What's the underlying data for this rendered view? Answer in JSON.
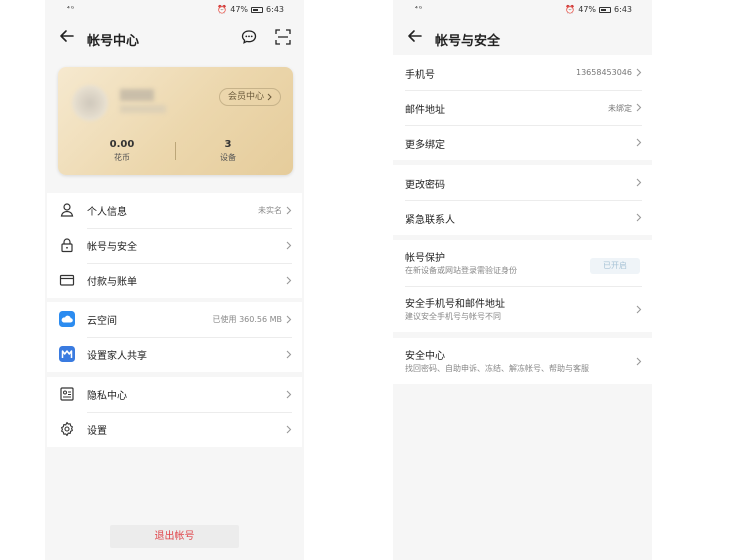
{
  "status_bar": {
    "signal": "⁴ᴳ",
    "alarm": "⏰",
    "battery": "47%",
    "time": "6:43"
  },
  "left": {
    "title": "帐号中心",
    "card": {
      "vip_label": "会员中心",
      "stats": [
        {
          "value": "0.00",
          "label": "花币"
        },
        {
          "value": "3",
          "label": "设备"
        }
      ],
      "accent": "#ecd7ad"
    },
    "groups": [
      [
        {
          "icon": "person-icon",
          "label": "个人信息",
          "value": "未实名"
        },
        {
          "icon": "lock-icon",
          "label": "帐号与安全",
          "value": ""
        },
        {
          "icon": "card-icon",
          "label": "付款与账单",
          "value": ""
        }
      ],
      [
        {
          "icon": "cloud-icon",
          "label": "云空间",
          "value": "已使用 360.56 MB"
        },
        {
          "icon": "family-icon",
          "label": "设置家人共享",
          "value": ""
        }
      ],
      [
        {
          "icon": "privacy-icon",
          "label": "隐私中心",
          "value": ""
        },
        {
          "icon": "gear-icon",
          "label": "设置",
          "value": ""
        }
      ]
    ],
    "logout_label": "退出帐号",
    "logout_color": "#e0464b"
  },
  "right": {
    "title": "帐号与安全",
    "groups": [
      [
        {
          "label": "手机号",
          "value": "13658453046"
        },
        {
          "label": "邮件地址",
          "value": "未绑定"
        },
        {
          "label": "更多绑定",
          "value": ""
        }
      ],
      [
        {
          "label": "更改密码",
          "value": ""
        },
        {
          "label": "紧急联系人",
          "value": ""
        }
      ],
      [
        {
          "label": "帐号保护",
          "sub": "在新设备或网站登录需验证身份",
          "toggle": "已开启"
        },
        {
          "label": "安全手机号和邮件地址",
          "sub": "建议安全手机号与帐号不同"
        }
      ],
      [
        {
          "label": "安全中心",
          "sub": "找回密码、自助申诉、冻结、解冻帐号、帮助与客服"
        }
      ]
    ]
  }
}
